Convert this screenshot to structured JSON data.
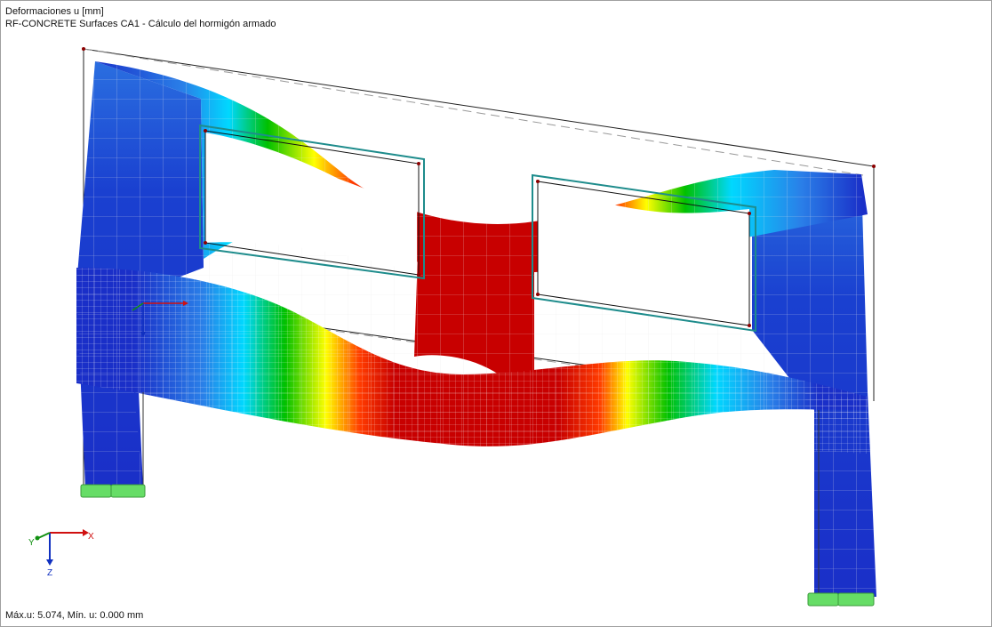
{
  "header": {
    "title": "Deformaciones u [mm]",
    "subtitle": "RF-CONCRETE Surfaces CA1 - Cálculo del hormigón armado"
  },
  "footer": {
    "summary": "Máx.u: 5.074, Mín. u: 0.000 mm"
  },
  "axes": {
    "x_label": "X",
    "y_label": "Y",
    "z_label": "Z"
  },
  "colors": {
    "low": "#1a2fc8",
    "mid_low": "#00d8ff",
    "mid": "#00c000",
    "mid_high": "#ffff00",
    "high": "#c80000",
    "support": "#66dd66",
    "opening_outline": "#1e8c8c",
    "axis_x": "#d01010",
    "axis_y": "#109010",
    "axis_z": "#1030c0"
  }
}
